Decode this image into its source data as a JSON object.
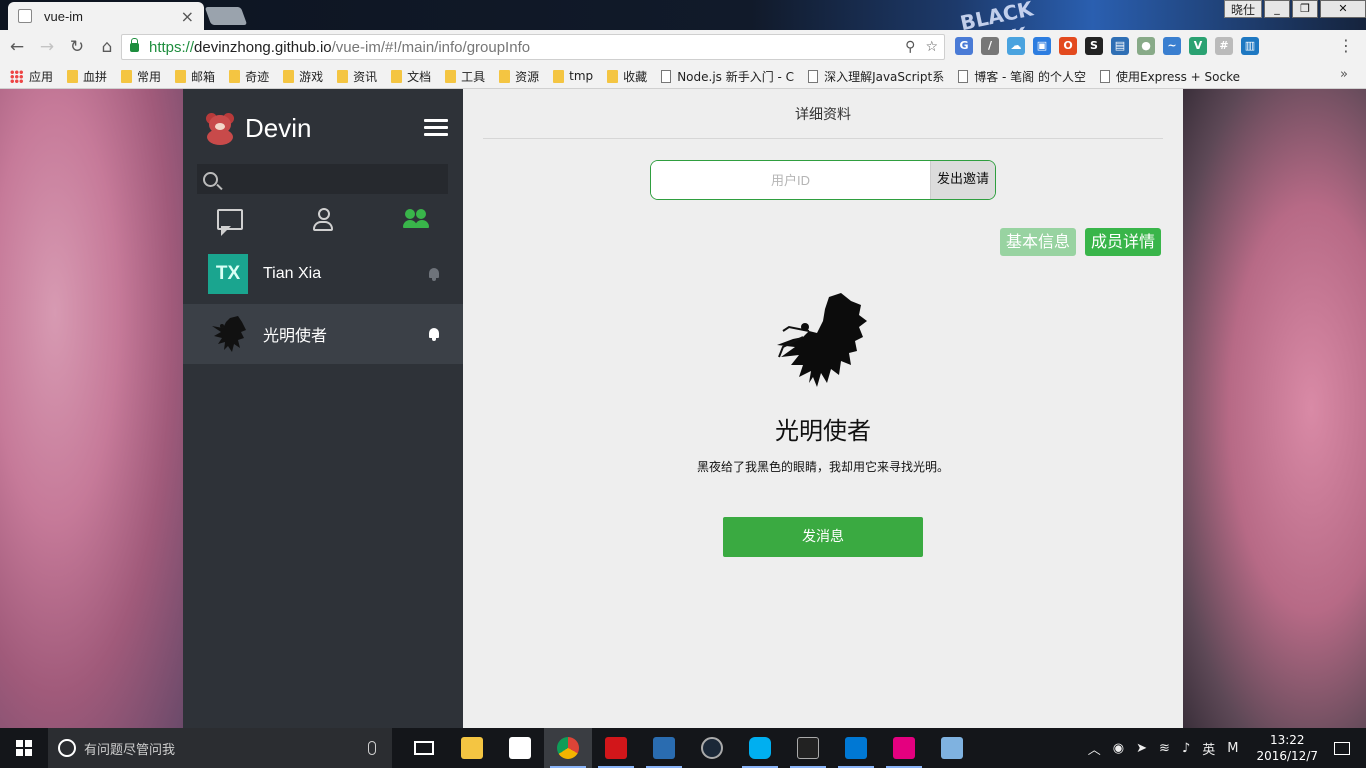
{
  "browser": {
    "tab_title": "vue-im",
    "tab_close": "×",
    "user_badge": "晓仕",
    "window_controls": [
      "_",
      "❐",
      "✕"
    ],
    "url_scheme": "https://",
    "url_host": "devinzhong.github.io",
    "url_path": "/vue-im/#!/main/info/groupInfo",
    "nav": {
      "back": "←",
      "forward": "→",
      "reload": "↻",
      "home": "⌂"
    },
    "bookmarks": [
      {
        "label": "应用",
        "kind": "apps"
      },
      {
        "label": "血拼",
        "kind": "folder"
      },
      {
        "label": "常用",
        "kind": "folder"
      },
      {
        "label": "邮箱",
        "kind": "folder"
      },
      {
        "label": "奇迹",
        "kind": "folder"
      },
      {
        "label": "游戏",
        "kind": "folder"
      },
      {
        "label": "资讯",
        "kind": "folder"
      },
      {
        "label": "文档",
        "kind": "folder"
      },
      {
        "label": "工具",
        "kind": "folder"
      },
      {
        "label": "资源",
        "kind": "folder"
      },
      {
        "label": "tmp",
        "kind": "folder"
      },
      {
        "label": "收藏",
        "kind": "folder"
      },
      {
        "label": "Node.js 新手入门 - C",
        "kind": "page"
      },
      {
        "label": "深入理解JavaScript系",
        "kind": "page"
      },
      {
        "label": "博客 - 笔阁 的个人空",
        "kind": "page"
      },
      {
        "label": "使用Express + Socke",
        "kind": "page"
      }
    ],
    "bookmarks_more": "»"
  },
  "sidebar": {
    "brand": "Devin",
    "search_placeholder": "",
    "contacts": [
      {
        "name": "Tian Xia",
        "avatar_text": "TX",
        "avatar_color": "#1aa58f"
      },
      {
        "name": "光明使者",
        "avatar_text": ""
      }
    ]
  },
  "main": {
    "title": "详细资料",
    "invite_placeholder": "用户ID",
    "invite_button": "发出邀请",
    "tab_basic": "基本信息",
    "tab_members": "成员详情",
    "group_name": "光明使者",
    "group_desc": "黑夜给了我黑色的眼睛，我却用它来寻找光明。",
    "send_button": "发消息"
  },
  "taskbar": {
    "search_placeholder": "有问题尽管问我",
    "tray_lang": "英",
    "tray_ime": "M",
    "time": "13:22",
    "date": "2016/12/7"
  },
  "colors": {
    "accent_green": "#39b54a",
    "sidebar_bg": "#2e3238",
    "main_bg": "#eeeeee"
  }
}
